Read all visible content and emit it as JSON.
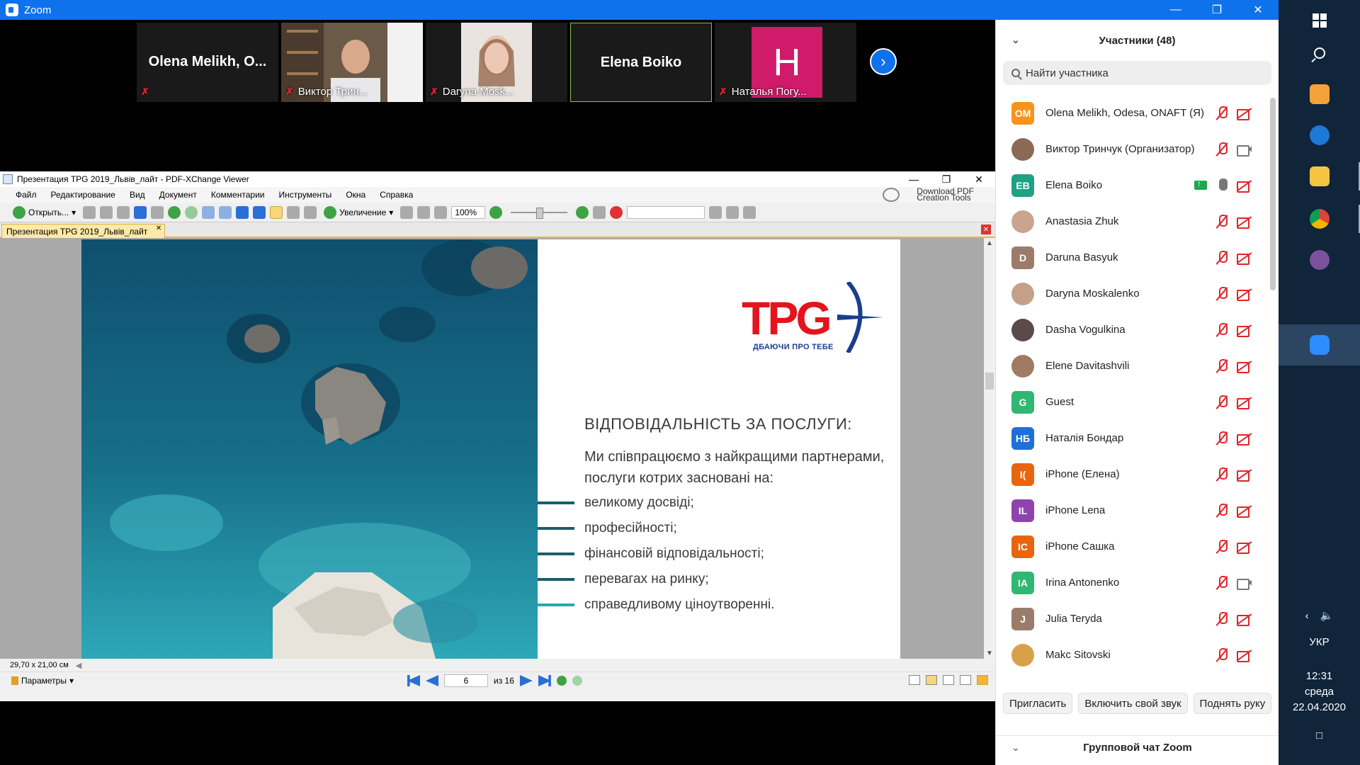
{
  "window": {
    "title": "Zoom"
  },
  "video_strip": {
    "tiles": [
      {
        "name": "Olena  Melikh,  O...",
        "label": ""
      },
      {
        "name": "",
        "label": "Виктор Трин..."
      },
      {
        "name": "",
        "label": "Daryna Mosk..."
      },
      {
        "name": "Elena Boiko",
        "label": ""
      },
      {
        "name": "",
        "label": "Наталья Погу...",
        "avatar_letter": "H",
        "avatar_color": "#d01a6a"
      }
    ]
  },
  "pdf": {
    "title": "Презентация TPG 2019_Львів_лайт - PDF-XChange Viewer",
    "menu": [
      "Файл",
      "Редактирование",
      "Вид",
      "Документ",
      "Комментарии",
      "Инструменты",
      "Окна",
      "Справка"
    ],
    "download_label_1": "Download PDF",
    "download_label_2": "Creation Tools",
    "toolbar": {
      "open": "Открыть...",
      "zoom": "Увеличение",
      "zoom_value": "100%"
    },
    "tab": "Презентация TPG 2019_Львів_лайт",
    "page_size": "29,70 x 21,00 см",
    "params": "Параметры",
    "page_current": "6",
    "page_of": "из 16"
  },
  "slide": {
    "logo_text": "TPG",
    "slogan": "ДБАЮЧИ ПРО ТЕБЕ",
    "heading": "ВІДПОВІДАЛЬНІСТЬ ЗА ПОСЛУГИ:",
    "intro": "Ми співпрацюємо з найкращими партнерами, послуги котрих засновані на:",
    "bullets": [
      "великому досвіді;",
      "професійності;",
      "фінансовій відповідальності;",
      "перевагах на ринку;",
      "справедливому ціноутворенні."
    ]
  },
  "participants": {
    "title": "Участники (48)",
    "search_placeholder": "Найти участника",
    "list": [
      {
        "initials": "OM",
        "color": "#f7941d",
        "name": "Olena Melikh, Odesa, ONAFT (Я)",
        "mic": "off",
        "cam": "off"
      },
      {
        "initials": "",
        "color": "#8a6a55",
        "name": "Виктор Тринчук (Организатор)",
        "mic": "off",
        "cam": "on"
      },
      {
        "initials": "EB",
        "color": "#1fa184",
        "name": "Elena Boiko",
        "mic": "on",
        "cam": "off",
        "share": true
      },
      {
        "initials": "",
        "color": "#c9a58f",
        "name": "Anastasia Zhuk",
        "mic": "off",
        "cam": "off"
      },
      {
        "initials": "D",
        "color": "#9b7b6a",
        "name": "Daruna Basyuk",
        "mic": "off",
        "cam": "off"
      },
      {
        "initials": "",
        "color": "#c4a08a",
        "name": "Daryna Moskalenko",
        "mic": "off",
        "cam": "off"
      },
      {
        "initials": "",
        "color": "#5a4a4a",
        "name": "Dasha Vogulkina",
        "mic": "off",
        "cam": "off"
      },
      {
        "initials": "",
        "color": "#a07a62",
        "name": "Elene Davitashvili",
        "mic": "off",
        "cam": "off"
      },
      {
        "initials": "G",
        "color": "#2eb872",
        "name": "Guest",
        "mic": "off",
        "cam": "off"
      },
      {
        "initials": "НБ",
        "color": "#1e6fd9",
        "name": "Наталія Бондар",
        "mic": "off",
        "cam": "off"
      },
      {
        "initials": "I(",
        "color": "#e8650f",
        "name": "iPhone (Елена)",
        "mic": "off",
        "cam": "off"
      },
      {
        "initials": "IL",
        "color": "#8e44ad",
        "name": "iPhone Lena",
        "mic": "off",
        "cam": "off"
      },
      {
        "initials": "IC",
        "color": "#e8650f",
        "name": "iPhone Сашка",
        "mic": "off",
        "cam": "off"
      },
      {
        "initials": "IA",
        "color": "#2eb872",
        "name": "Irina Antonenko",
        "mic": "off",
        "cam": "on"
      },
      {
        "initials": "J",
        "color": "#9b7b6a",
        "name": "Julia Teryda",
        "mic": "off",
        "cam": "off"
      },
      {
        "initials": "",
        "color": "#d9a04a",
        "name": "Makc Sitovski",
        "mic": "off",
        "cam": "off"
      }
    ],
    "buttons": {
      "invite": "Пригласить",
      "unmute": "Включить свой звук",
      "raise": "Поднять руку"
    },
    "chat_title": "Групповой чат Zoom"
  },
  "taskbar": {
    "lang": "УКР",
    "time": "12:31",
    "day": "среда",
    "date": "22.04.2020"
  }
}
